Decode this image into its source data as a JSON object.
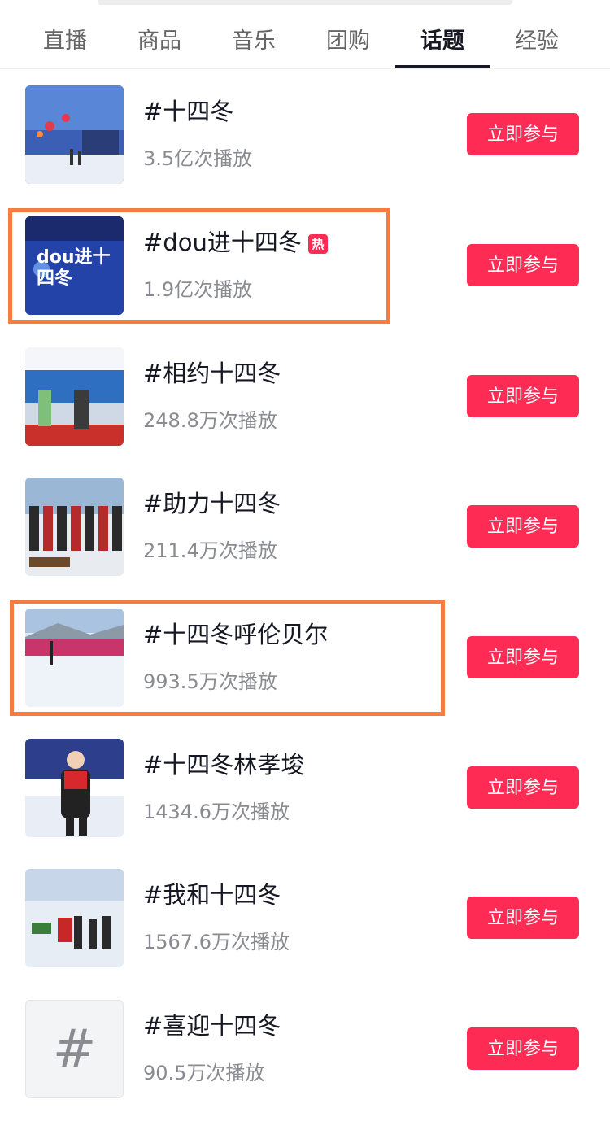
{
  "tabs": [
    {
      "label": "直播",
      "active": false
    },
    {
      "label": "商品",
      "active": false
    },
    {
      "label": "音乐",
      "active": false
    },
    {
      "label": "团购",
      "active": false
    },
    {
      "label": "话题",
      "active": true
    },
    {
      "label": "经验",
      "active": false
    }
  ],
  "topics": [
    {
      "title": "#十四冬",
      "plays": "3.5亿次播放",
      "hot": false,
      "button": "立即参与"
    },
    {
      "title": "#dou进十四冬",
      "plays": "1.9亿次播放",
      "hot": true,
      "hot_label": "热",
      "button": "立即参与",
      "thumb_text": "dou进十四冬"
    },
    {
      "title": "#相约十四冬",
      "plays": "248.8万次播放",
      "hot": false,
      "button": "立即参与"
    },
    {
      "title": "#助力十四冬",
      "plays": "211.4万次播放",
      "hot": false,
      "button": "立即参与"
    },
    {
      "title": "#十四冬呼伦贝尔",
      "plays": "993.5万次播放",
      "hot": false,
      "button": "立即参与"
    },
    {
      "title": "#十四冬林孝埈",
      "plays": "1434.6万次播放",
      "hot": false,
      "button": "立即参与"
    },
    {
      "title": "#我和十四冬",
      "plays": "1567.6万次播放",
      "hot": false,
      "button": "立即参与"
    },
    {
      "title": "#喜迎十四冬",
      "plays": "90.5万次播放",
      "hot": false,
      "button": "立即参与",
      "thumb_text": "#"
    }
  ],
  "colors": {
    "accent": "#fe2c55",
    "highlight": "#f57d42",
    "text_primary": "#161823",
    "text_secondary": "#8a8b91"
  }
}
